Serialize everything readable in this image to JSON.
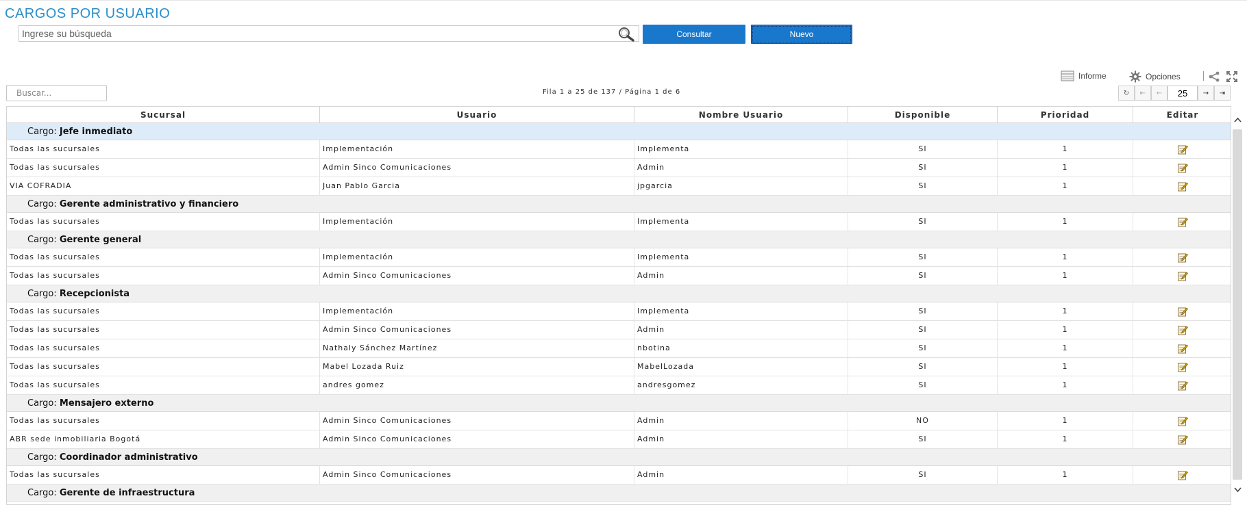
{
  "header": {
    "title": "CARGOS POR USUARIO",
    "search_placeholder": "Ingrese su búsqueda",
    "consultar_label": "Consultar",
    "nuevo_label": "Nuevo"
  },
  "toolbar": {
    "informe_label": "Informe",
    "opciones_label": "Opciones"
  },
  "grid_search": {
    "placeholder": "Buscar..."
  },
  "pager": {
    "info": "Fila 1 a 25 de 137 / Página 1 de 6",
    "page_size": "25"
  },
  "columns": [
    "Sucursal",
    "Usuario",
    "Nombre Usuario",
    "Disponible",
    "Prioridad",
    "Editar"
  ],
  "group_prefix": "Cargo:",
  "groups": [
    {
      "name": "Jefe inmediato",
      "rows": [
        [
          "Todas las sucursales",
          "Implementación",
          "Implementa",
          "SI",
          "1"
        ],
        [
          "Todas las sucursales",
          "Admin Sinco Comunicaciones",
          "Admin",
          "SI",
          "1"
        ],
        [
          "VIA COFRADIA",
          "Juan Pablo Garcia",
          "jpgarcia",
          "SI",
          "1"
        ]
      ]
    },
    {
      "name": "Gerente administrativo y financiero",
      "rows": [
        [
          "Todas las sucursales",
          "Implementación",
          "Implementa",
          "SI",
          "1"
        ]
      ]
    },
    {
      "name": "Gerente general",
      "rows": [
        [
          "Todas las sucursales",
          "Implementación",
          "Implementa",
          "SI",
          "1"
        ],
        [
          "Todas las sucursales",
          "Admin Sinco Comunicaciones",
          "Admin",
          "SI",
          "1"
        ]
      ]
    },
    {
      "name": "Recepcionista",
      "rows": [
        [
          "Todas las sucursales",
          "Implementación",
          "Implementa",
          "SI",
          "1"
        ],
        [
          "Todas las sucursales",
          "Admin Sinco Comunicaciones",
          "Admin",
          "SI",
          "1"
        ],
        [
          "Todas las sucursales",
          "Nathaly Sánchez Martínez",
          "nbotina",
          "SI",
          "1"
        ],
        [
          "Todas las sucursales",
          "Mabel Lozada Ruiz",
          "MabelLozada",
          "SI",
          "1"
        ],
        [
          "Todas las sucursales",
          "andres gomez",
          "andresgomez",
          "SI",
          "1"
        ]
      ]
    },
    {
      "name": "Mensajero externo",
      "rows": [
        [
          "Todas las sucursales",
          "Admin Sinco Comunicaciones",
          "Admin",
          "NO",
          "1"
        ],
        [
          "ABR sede inmobiliaria Bogotá",
          "Admin Sinco Comunicaciones",
          "Admin",
          "SI",
          "1"
        ]
      ]
    },
    {
      "name": "Coordinador administrativo",
      "rows": [
        [
          "Todas las sucursales",
          "Admin Sinco Comunicaciones",
          "Admin",
          "SI",
          "1"
        ]
      ]
    },
    {
      "name": "Gerente de infraestructura",
      "rows": []
    }
  ]
}
